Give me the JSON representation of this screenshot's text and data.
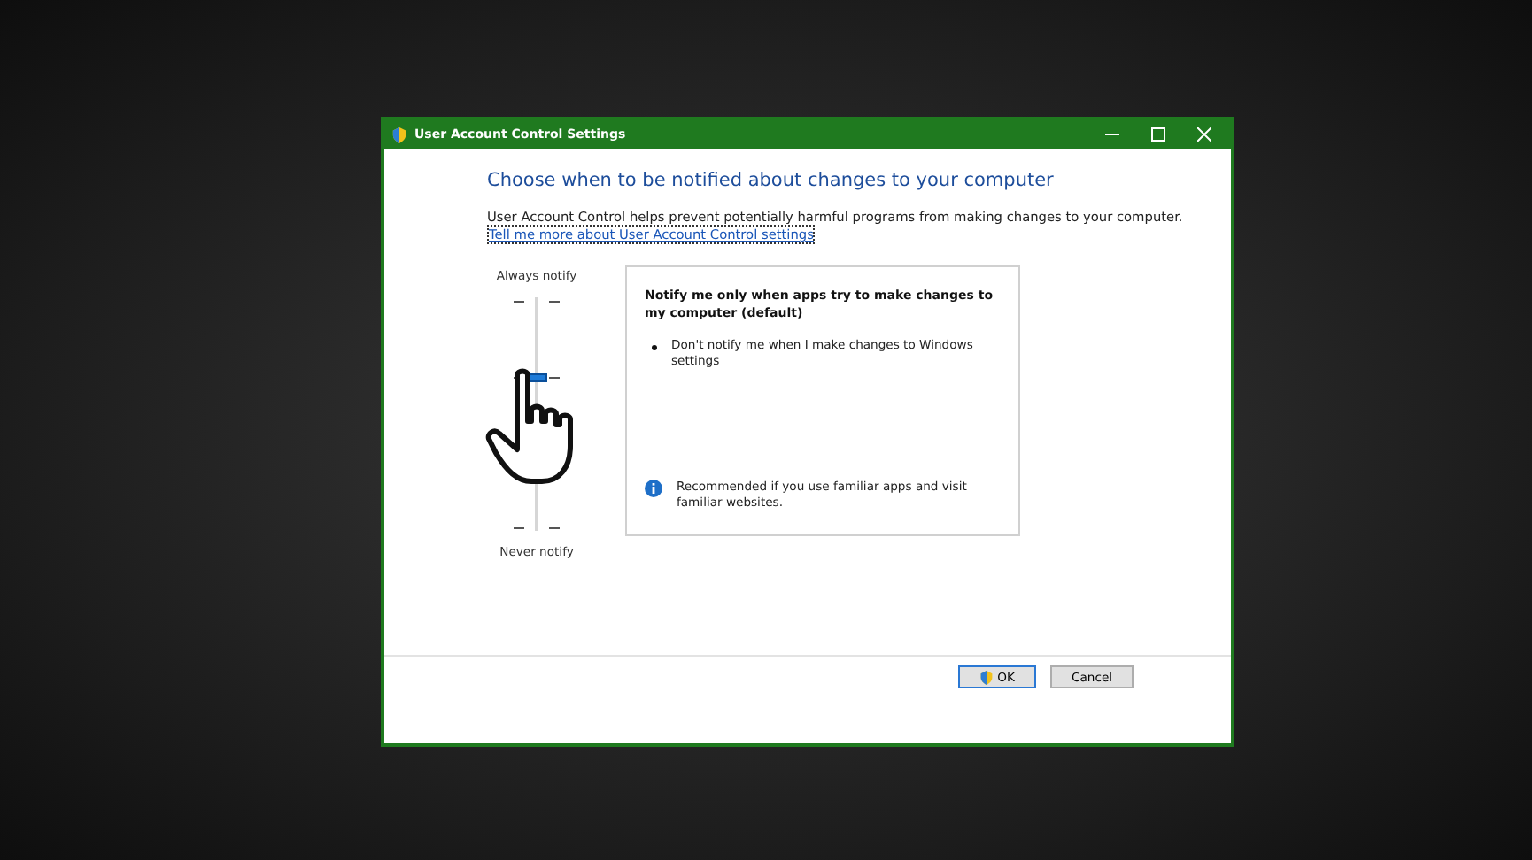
{
  "window": {
    "title": "User Account Control Settings"
  },
  "heading": "Choose when to be notified about changes to your computer",
  "description": "User Account Control helps prevent potentially harmful programs from making changes to your computer.",
  "link": "Tell me more about User Account Control settings",
  "slider": {
    "top_label": "Always notify",
    "bottom_label": "Never notify",
    "level": 0.667
  },
  "info_panel": {
    "title": "Notify me only when apps try to make changes to my computer (default)",
    "bullets": [
      "Don't notify me when I make changes to Windows settings"
    ],
    "note": "Recommended if you use familiar apps and visit familiar websites."
  },
  "buttons": [
    {
      "label": "OK",
      "kind": "primary"
    },
    {
      "label": "Cancel",
      "kind": "normal"
    }
  ]
}
